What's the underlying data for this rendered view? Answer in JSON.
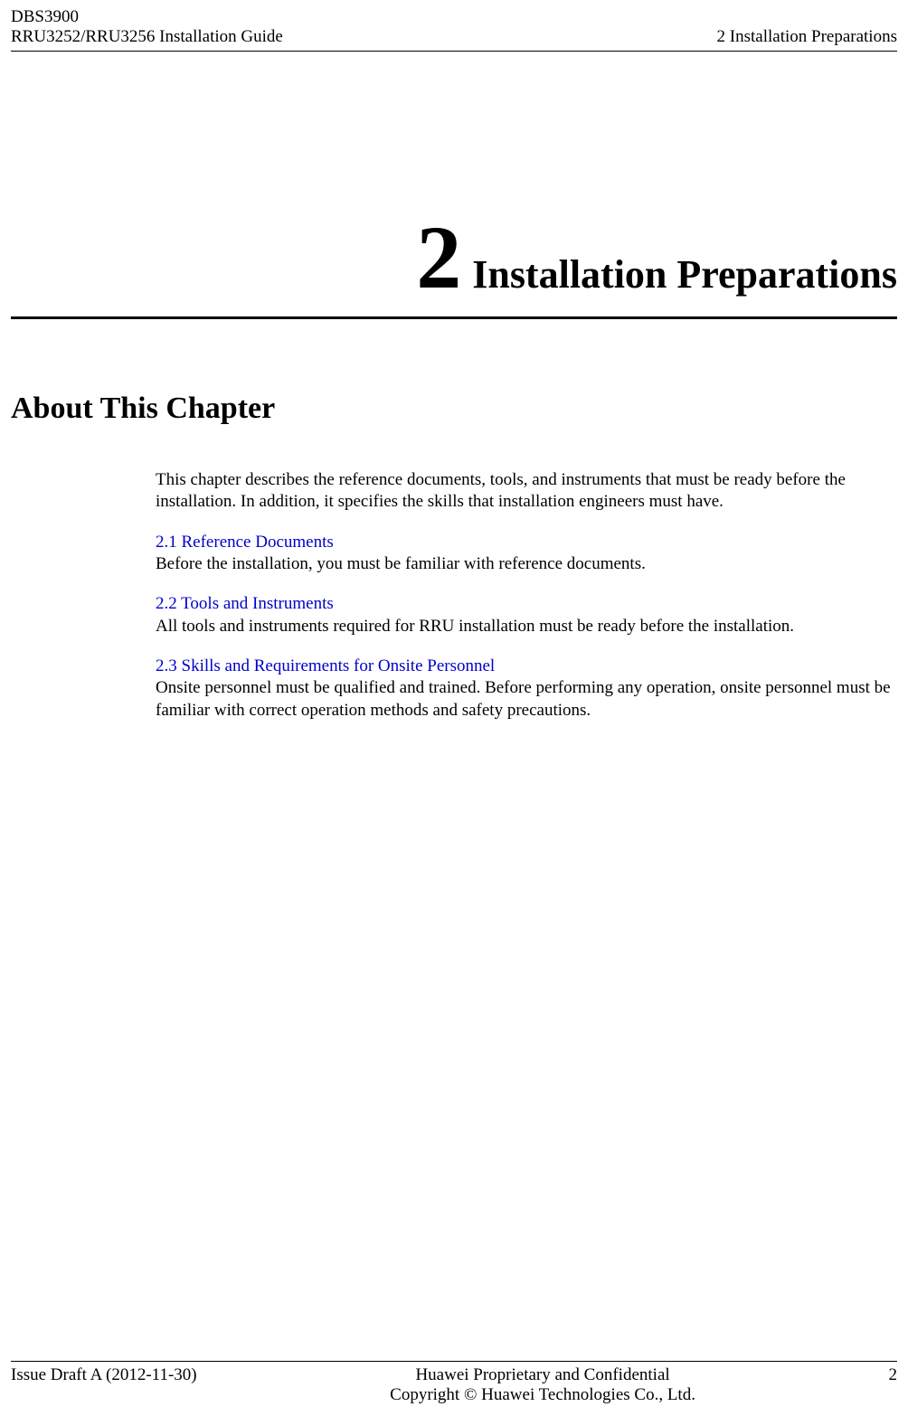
{
  "header": {
    "product": "DBS3900",
    "guide": "RRU3252/RRU3256 Installation Guide",
    "section": "2 Installation Preparations"
  },
  "chapter": {
    "number": "2",
    "title": "Installation Preparations"
  },
  "about": {
    "heading": "About This Chapter",
    "intro": "This chapter describes the reference documents, tools, and instruments that must be ready before the installation. In addition, it specifies the skills that installation engineers must have."
  },
  "sections": [
    {
      "link": "2.1 Reference Documents",
      "desc": "Before the installation, you must be familiar with reference documents."
    },
    {
      "link": "2.2 Tools and Instruments",
      "desc": "All tools and instruments required for RRU installation must be ready before the installation."
    },
    {
      "link": "2.3 Skills and Requirements for Onsite Personnel",
      "desc": "Onsite personnel must be qualified and trained. Before performing any operation, onsite personnel must be familiar with correct operation methods and safety precautions."
    }
  ],
  "footer": {
    "issue": "Issue Draft A (2012-11-30)",
    "proprietary": "Huawei Proprietary and Confidential",
    "copyright": "Copyright © Huawei Technologies Co., Ltd.",
    "page": "2"
  }
}
